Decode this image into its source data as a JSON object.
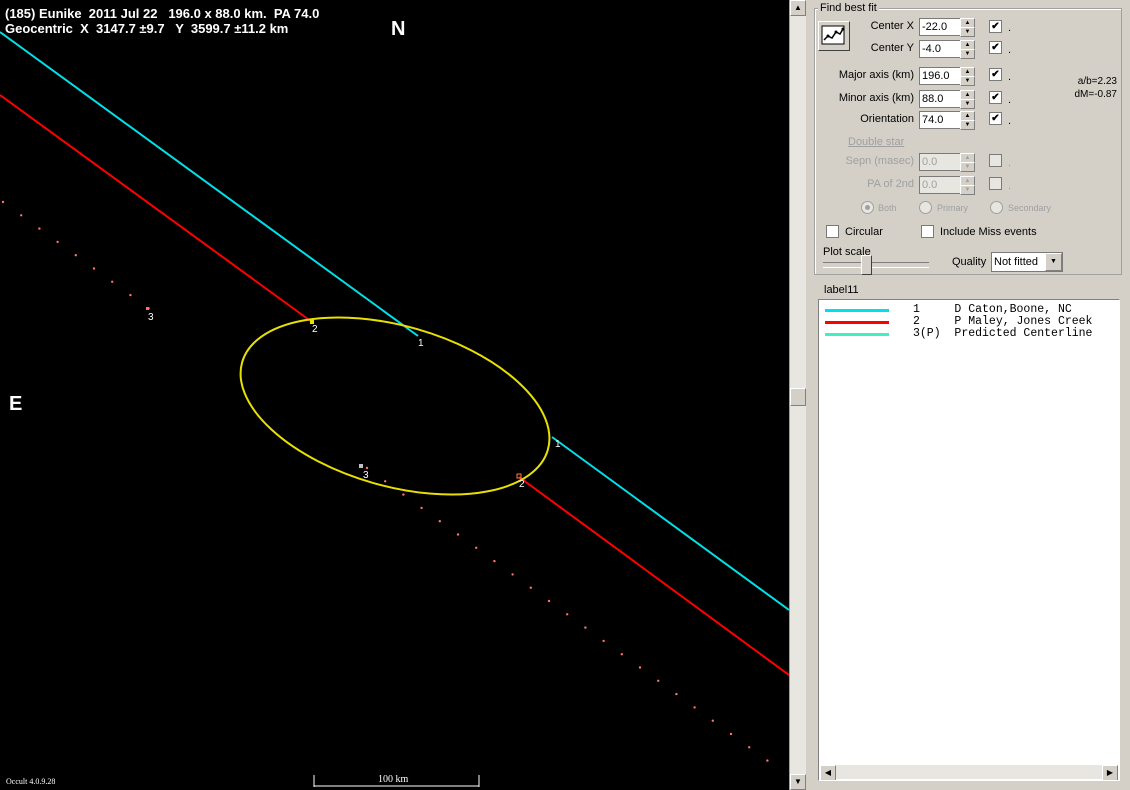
{
  "plot": {
    "title_line1": "(185) Eunike  2011 Jul 22   196.0 x 88.0 km.  PA 74.0",
    "title_line2": "Geocentric  X  3147.7 ±9.7   Y  3599.7 ±11.2 km",
    "north_label": "N",
    "east_label": "E",
    "version": "Occult 4.0.9.28",
    "scale_label": "100 km",
    "chord_labels": {
      "c1": "1",
      "c2": "2",
      "c3": "3"
    },
    "colors": {
      "chord1": "#00e0e8",
      "chord2": "#ff0000",
      "ellipse": "#e8e000",
      "predicted": "#ff7070"
    }
  },
  "panel": {
    "group_title": "Find best fit",
    "fit_button_icon": "chart-fit-icon",
    "center_x": {
      "label": "Center X",
      "value": "-22.0",
      "checked": "✔"
    },
    "center_y": {
      "label": "Center Y",
      "value": "-4.0",
      "checked": "✔"
    },
    "major_axis": {
      "label": "Major axis (km)",
      "value": "196.0",
      "checked": "✔"
    },
    "minor_axis": {
      "label": "Minor axis (km)",
      "value": "88.0",
      "checked": "✔"
    },
    "orientation": {
      "label": "Orientation",
      "value": "74.0",
      "checked": "✔"
    },
    "dot": ".",
    "ab_ratio": "a/b=2.23",
    "dm": "dM=-0.87",
    "double_star": "Double star",
    "sepn": {
      "label": "Sepn (masec)",
      "value": "0.0"
    },
    "pa2nd": {
      "label": "PA of 2nd",
      "value": "0.0"
    },
    "radio_both": "Both",
    "radio_primary": "Primary",
    "radio_secondary": "Secondary",
    "circular": "Circular",
    "include_miss": "Include Miss events",
    "plot_scale": "Plot scale",
    "quality_label": "Quality",
    "quality_value": "Not fitted",
    "label11": "label11",
    "list": [
      {
        "num": "1     ",
        "text": "D Caton,Boone, NC",
        "color": "#00e0e8"
      },
      {
        "num": "2     ",
        "text": "P Maley, Jones Creek",
        "color": "#ff0000"
      },
      {
        "num": "3(P)  ",
        "text": "Predicted Centerline",
        "color": "#40f0c0"
      }
    ]
  }
}
